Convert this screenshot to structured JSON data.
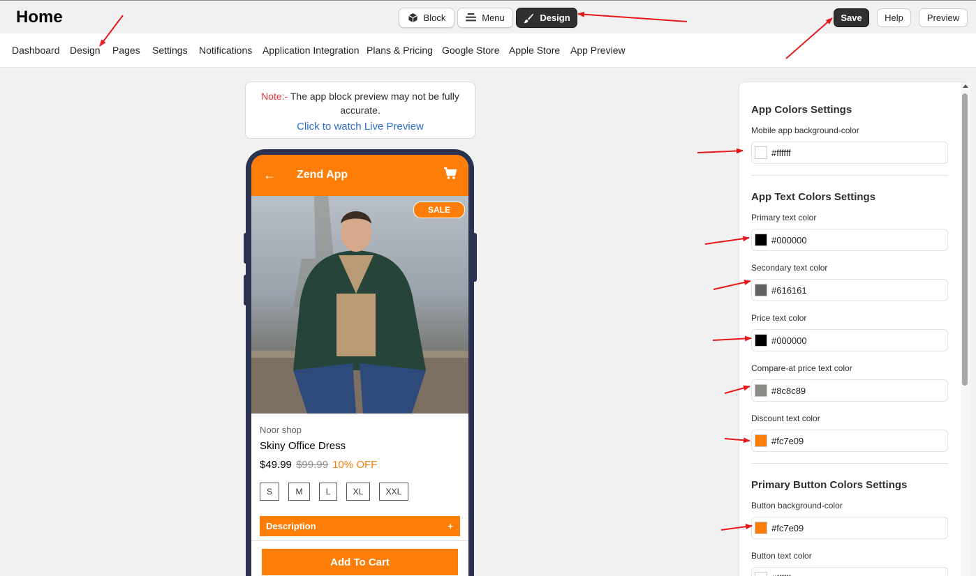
{
  "header": {
    "title": "Home"
  },
  "mode_switch": {
    "block": "Block",
    "menu": "Menu",
    "design": "Design",
    "active": "Design"
  },
  "actions": {
    "save": "Save",
    "help": "Help",
    "preview": "Preview"
  },
  "nav": {
    "items": [
      "Dashboard",
      "Design",
      "Pages",
      "Settings",
      "Notifications",
      "Application Integration",
      "Plans & Pricing",
      "Google Store",
      "Apple Store",
      "App Preview"
    ]
  },
  "note": {
    "label": "Note:-",
    "text": " The app block preview may not be fully accurate.",
    "link": "Click to watch Live Preview"
  },
  "phone": {
    "app_title": "Zend App",
    "sale_badge": "SALE",
    "shop_name": "Noor shop",
    "product_name": "Skiny Office Dress",
    "price": "$49.99",
    "compare_price": "$99.99",
    "discount": "10% OFF",
    "sizes": [
      "S",
      "M",
      "L",
      "XL",
      "XXL"
    ],
    "description_label": "Description",
    "description_toggle": "+",
    "add_to_cart": "Add To Cart"
  },
  "settings": {
    "app_colors": {
      "title": "App Colors Settings",
      "bg_label": "Mobile app background-color",
      "bg_value": "#ffffff"
    },
    "text_colors": {
      "title": "App Text Colors Settings",
      "fields": [
        {
          "label": "Primary text color",
          "value": "#000000"
        },
        {
          "label": "Secondary text color",
          "value": "#616161"
        },
        {
          "label": "Price text color",
          "value": "#000000"
        },
        {
          "label": "Compare-at price text color",
          "value": "#8c8c89"
        },
        {
          "label": "Discount text color",
          "value": "#fc7e09"
        }
      ]
    },
    "button_colors": {
      "title": "Primary Button Colors Settings",
      "fields": [
        {
          "label": "Button background-color",
          "value": "#fc7e09"
        },
        {
          "label": "Button text color",
          "value": "#ffffff"
        }
      ]
    }
  },
  "colors": {
    "accent": "#fc7e09",
    "dark": "#303030",
    "annotation": "#e8191b",
    "phone_frame": "#2a3250"
  }
}
